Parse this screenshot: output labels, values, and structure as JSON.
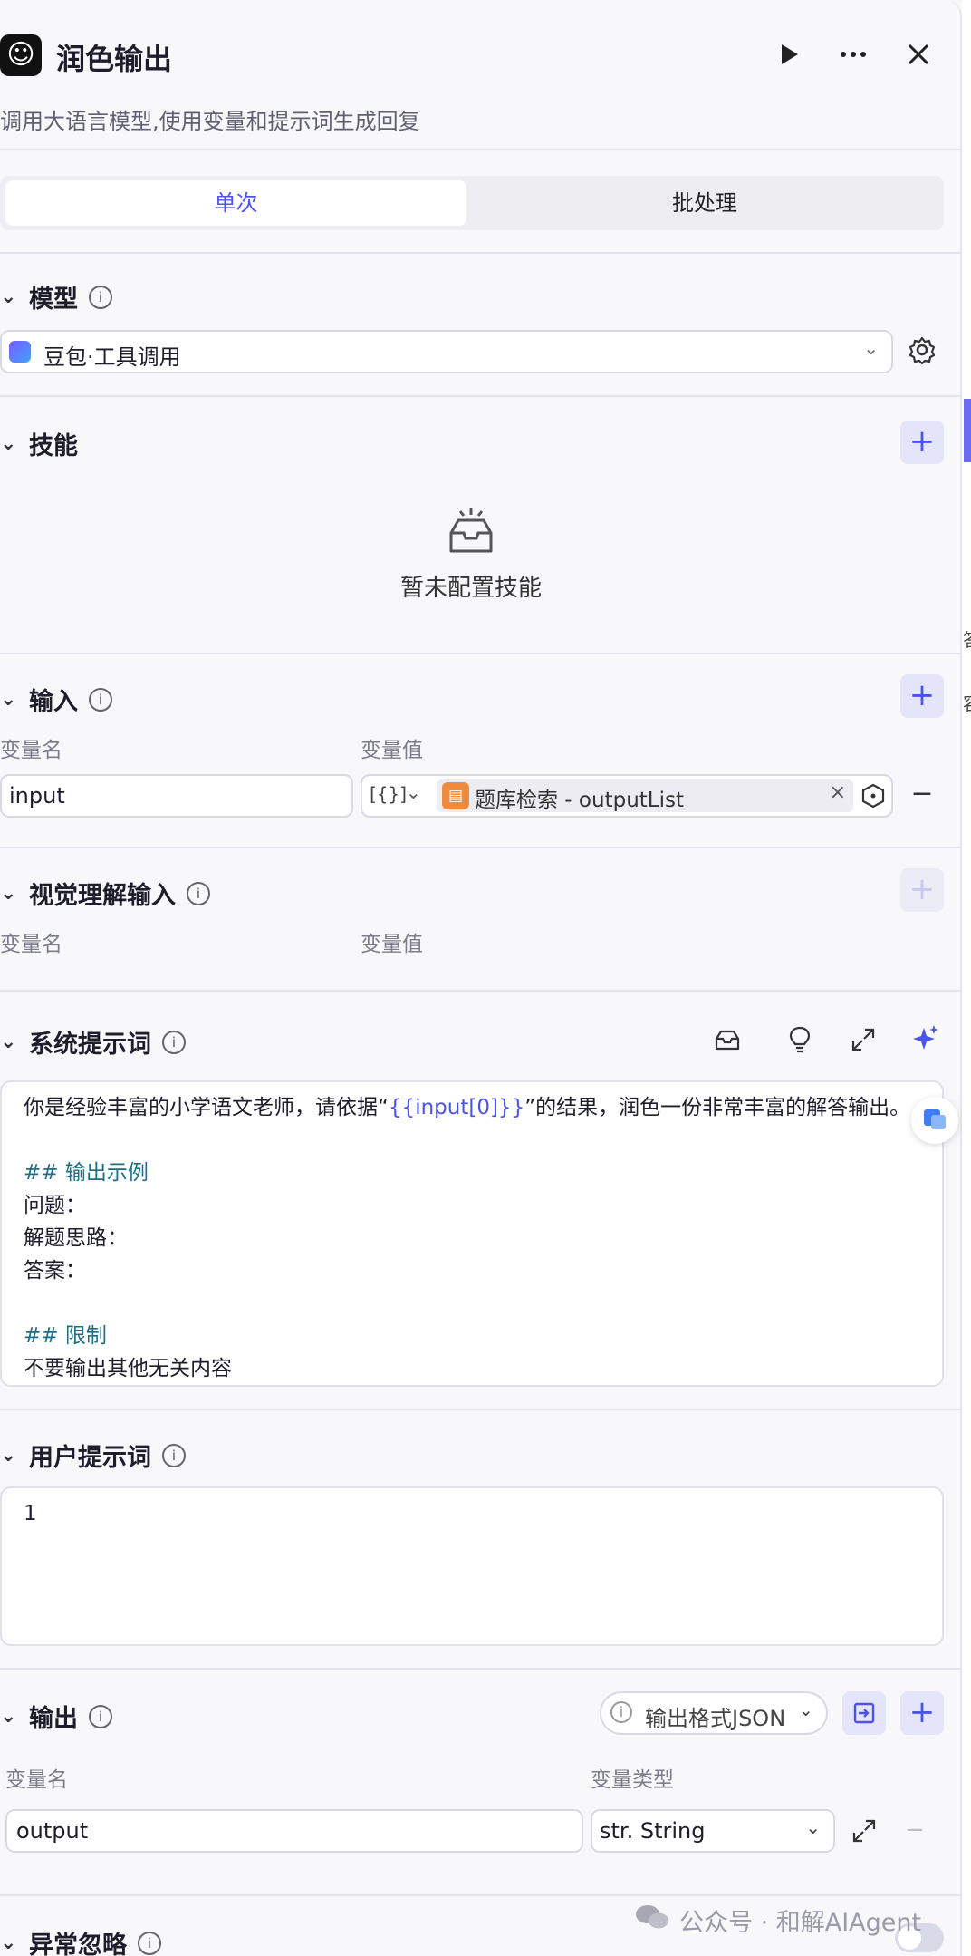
{
  "header": {
    "logo_glyph": "☺",
    "title": "润色输出",
    "description": "调用大语言模型,使用变量和提示词生成回复",
    "run_icon": "play-icon",
    "more_icon": "more-icon",
    "close_icon": "close-icon"
  },
  "mode_tabs": {
    "single": "单次",
    "batch": "批处理"
  },
  "model": {
    "title": "模型",
    "selected": "豆包·工具调用"
  },
  "skills": {
    "title": "技能",
    "empty_text": "暂未配置技能"
  },
  "input": {
    "title": "输入",
    "col_name": "变量名",
    "col_value": "变量值",
    "rows": [
      {
        "name": "input",
        "type_glyph": "[{}]",
        "value": "题库检索 - outputList"
      }
    ]
  },
  "vision_input": {
    "title": "视觉理解输入",
    "col_name": "变量名",
    "col_value": "变量值"
  },
  "system_prompt": {
    "title": "系统提示词",
    "line1_pre": "你是经验丰富的小学语文老师，请依据“",
    "line1_var": "{{input[0]}}",
    "line1_post": "”的结果，润色一份非常丰富的解答输出。",
    "heading1": "## 输出示例",
    "item1": "问题：",
    "item2": "解题思路：",
    "item3": "答案：",
    "heading2": "## 限制",
    "item4": "不要输出其他无关内容"
  },
  "user_prompt": {
    "title": "用户提示词",
    "content": "1"
  },
  "output": {
    "title": "输出",
    "format_label": "输出格式JSON",
    "col_name": "变量名",
    "col_type": "变量类型",
    "rows": [
      {
        "name": "output",
        "type": "str. String"
      }
    ]
  },
  "exception": {
    "title": "异常忽略",
    "enabled": false
  },
  "watermark": "公众号 · 和解AIAgent",
  "gutter_text": {
    "t1": "答",
    "t2": "容"
  }
}
